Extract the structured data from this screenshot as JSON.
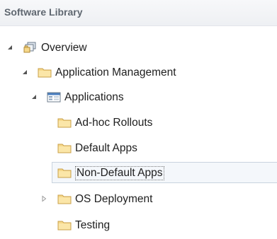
{
  "panel": {
    "title": "Software Library"
  },
  "tree": {
    "items": [
      {
        "label": "Overview",
        "icon": "overview-icon",
        "expanded": true
      },
      {
        "label": "Application Management",
        "icon": "folder-icon",
        "expanded": true
      },
      {
        "label": "Applications",
        "icon": "applications-icon",
        "expanded": true
      },
      {
        "label": "Ad-hoc Rollouts",
        "icon": "folder-icon"
      },
      {
        "label": "Default Apps",
        "icon": "folder-icon"
      },
      {
        "label": "Non-Default Apps",
        "icon": "folder-icon",
        "selected": true
      },
      {
        "label": "OS Deployment",
        "icon": "folder-icon",
        "expanded": false
      },
      {
        "label": "Testing",
        "icon": "folder-icon"
      }
    ]
  },
  "colors": {
    "header_text": "#5f6770",
    "folder_fill": "#f6d88a",
    "folder_stroke": "#c9a04a",
    "selection_border": "#c9d3df"
  }
}
